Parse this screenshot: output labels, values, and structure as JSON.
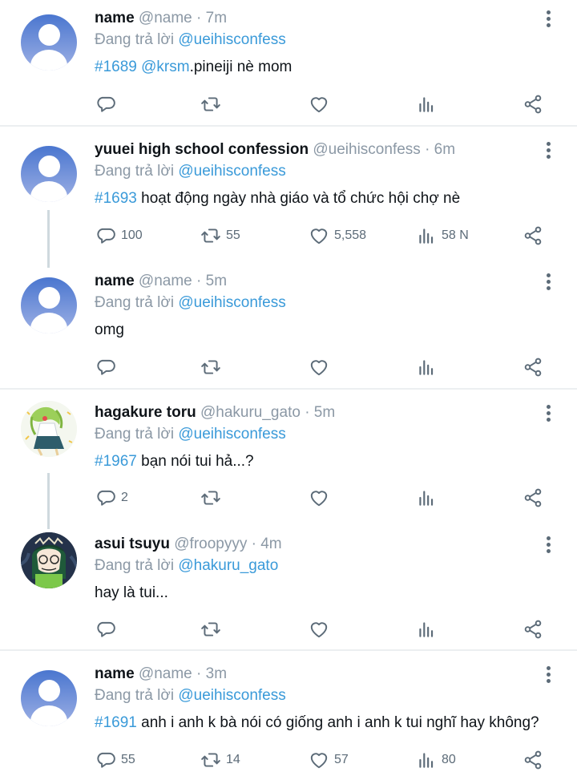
{
  "colors": {
    "accent": "#3a9ad9",
    "text": "#0f1419",
    "muted": "#8b98a5",
    "icon": "#5c6b78",
    "separator": "#eceff1"
  },
  "icons": {
    "reply": "speech-bubble-icon",
    "retweet": "retweet-arrows-icon",
    "like": "heart-icon",
    "views": "bar-chart-icon",
    "share": "share-nodes-icon",
    "more": "vertical-dots-icon"
  },
  "tweets": [
    {
      "name": "name",
      "meta": "@name · 7m",
      "reply_prefix": "Đang trả lời",
      "reply_to": "@ueihisconfess",
      "tag": "#1689",
      "mention": "@krsm",
      "text": ".pineiji nè mom",
      "stats": {
        "reply": "",
        "retweet": "",
        "like": "",
        "views": ""
      }
    },
    {
      "name": "yuuei high school confession",
      "meta": "@ueihisconfess · 6m",
      "reply_prefix": "Đang trả lời",
      "reply_to": "@ueihisconfess",
      "tag": "#1693",
      "text": " hoạt động ngày nhà giáo và tổ chức hội chợ nè",
      "stats": {
        "reply": "100",
        "retweet": "55",
        "like": "5,558",
        "views": "58 N"
      }
    },
    {
      "name": "name",
      "meta": "@name · 5m",
      "reply_prefix": "Đang trả lời",
      "reply_to": "@ueihisconfess",
      "text": "omg",
      "stats": {
        "reply": "",
        "retweet": "",
        "like": "",
        "views": ""
      }
    },
    {
      "name": "hagakure toru",
      "meta": "@hakuru_gato · 5m",
      "reply_prefix": "Đang trả lời",
      "reply_to": "@ueihisconfess",
      "tag": "#1967",
      "text": " bạn nói tui hả...?",
      "stats": {
        "reply": "2",
        "retweet": "",
        "like": "",
        "views": ""
      }
    },
    {
      "name": "asui tsuyu",
      "meta": "@froopyyy · 4m",
      "reply_prefix": "Đang trả lời",
      "reply_to": "@hakuru_gato",
      "text": "hay là tui...",
      "stats": {
        "reply": "",
        "retweet": "",
        "like": "",
        "views": ""
      }
    },
    {
      "name": "name",
      "meta": "@name · 3m",
      "reply_prefix": "Đang trả lời",
      "reply_to": "@ueihisconfess",
      "tag": "#1691",
      "text": " anh i anh k bà nói có giống anh i anh k tui nghĩ hay không?",
      "stats": {
        "reply": "55",
        "retweet": "14",
        "like": "57",
        "views": "80"
      }
    }
  ]
}
